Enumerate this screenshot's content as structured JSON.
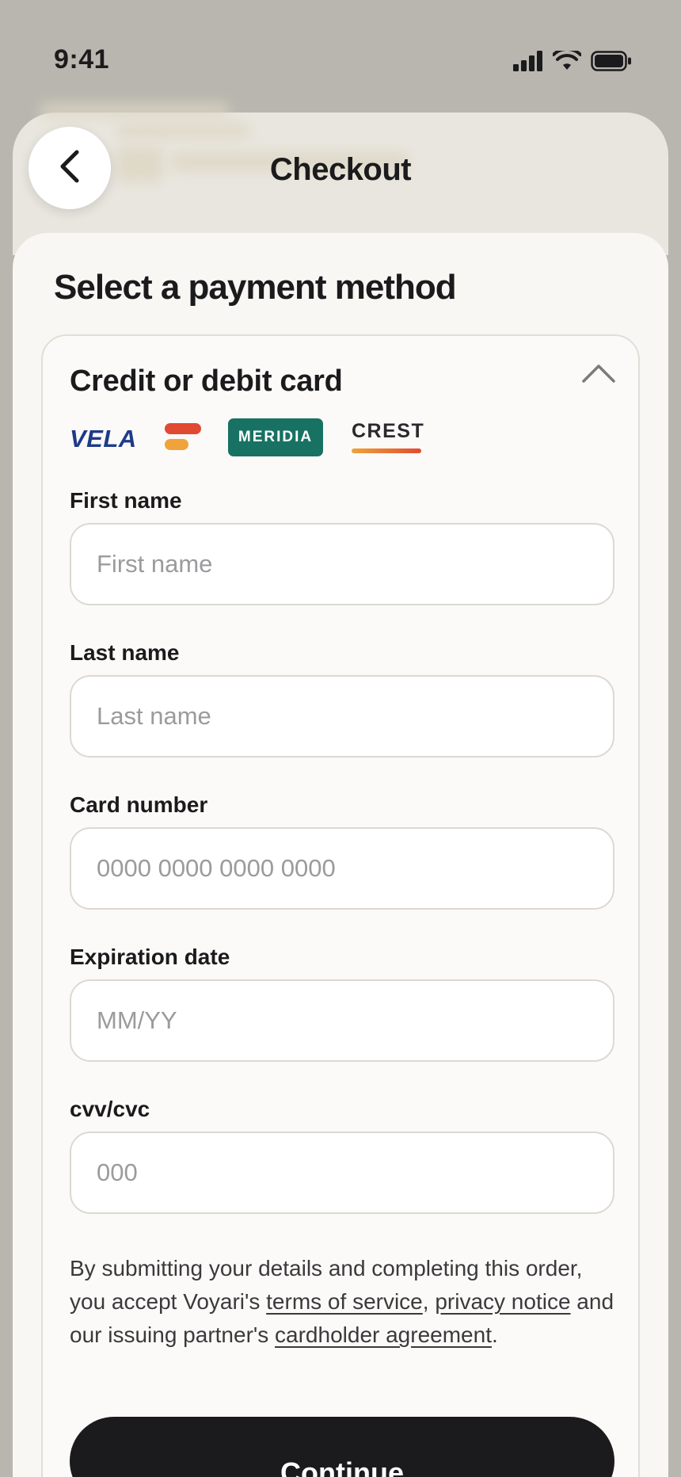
{
  "status_bar": {
    "time": "9:41",
    "icons": [
      "cellular-signal-icon",
      "wifi-icon",
      "battery-icon"
    ]
  },
  "header": {
    "title": "Checkout",
    "back_icon": "chevron-left-icon"
  },
  "sheet": {
    "title": "Select a payment method"
  },
  "payment_panel": {
    "title": "Credit or debit card",
    "collapse_icon": "chevron-up-icon",
    "brands": {
      "vela": "VELA",
      "meridia": "MERIDIA",
      "crest": "CREST"
    },
    "fields": {
      "first_name": {
        "label": "First name",
        "placeholder": "First name",
        "value": ""
      },
      "last_name": {
        "label": "Last name",
        "placeholder": "Last name",
        "value": ""
      },
      "card_number": {
        "label": "Card number",
        "placeholder": "0000 0000 0000 0000",
        "value": ""
      },
      "expiration": {
        "label": "Expiration date",
        "placeholder": "MM/YY",
        "value": ""
      },
      "cvv": {
        "label": "cvv/cvc",
        "placeholder": "000",
        "value": ""
      }
    },
    "legal": {
      "part1": "By submitting your details and completing this order, you accept Voyari's ",
      "terms_link": "terms of service",
      "part2": ", ",
      "privacy_link": "privacy notice",
      "part3": " and our issuing partner's ",
      "cardholder_link": "cardholder agreement",
      "part4": "."
    },
    "continue_label": "Continue"
  },
  "colors": {
    "backdrop": "#b9b6af",
    "sheet": "#f8f7f4",
    "primary_button": "#1b1b1d",
    "meridia_brand": "#177263",
    "vela_brand": "#1e3a8a"
  }
}
